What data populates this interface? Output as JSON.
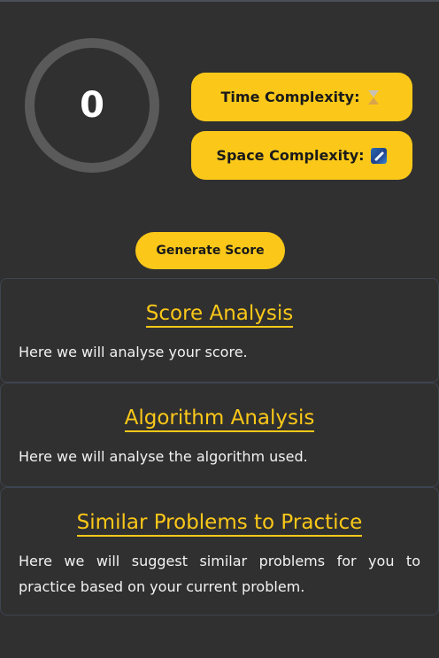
{
  "score": {
    "value": "0"
  },
  "complexity": {
    "time_label": "Time Complexity:",
    "time_icon": "hourglass-icon",
    "space_label": "Space Complexity:",
    "space_icon": "rocket-icon"
  },
  "actions": {
    "generate_label": "Generate Score"
  },
  "cards": [
    {
      "title": "Score Analysis",
      "text": "Here we will analyse your score."
    },
    {
      "title": "Algorithm Analysis",
      "text": "Here we will analyse the algorithm used."
    },
    {
      "title": "Similar Problems to Practice",
      "text": "Here we will suggest similar problems for you to practice based on your current problem."
    }
  ],
  "colors": {
    "background": "#303030",
    "accent": "#fbc819",
    "ring": "#5a5a5a",
    "card_border": "#3e4450"
  }
}
